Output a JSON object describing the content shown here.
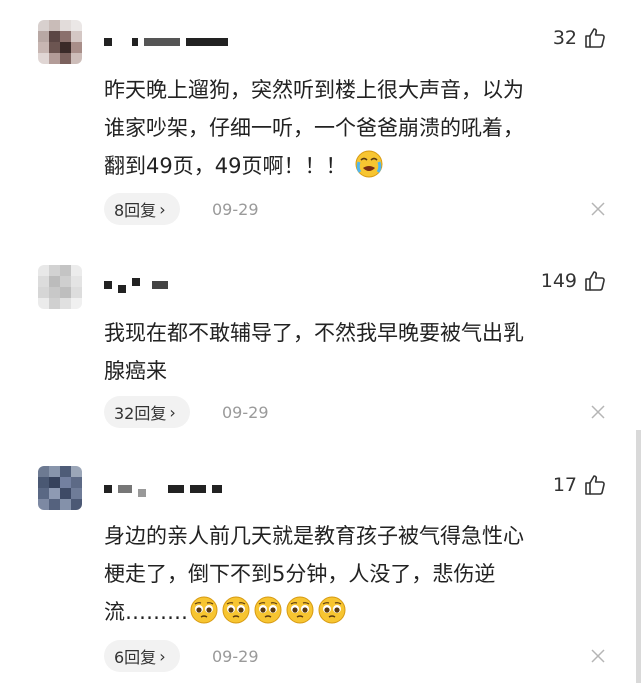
{
  "comments": [
    {
      "likes": "32",
      "text_lines": [
        "昨天晚上遛狗，突然听到楼上很大声音，以为",
        "谁家吵架，仔细一听，一个爸爸崩溃的吼着，",
        "翻到49页，49页啊！！！"
      ],
      "emoji_name": "crying-face-emoji",
      "reply_label": "8回复",
      "date": "09-29"
    },
    {
      "likes": "149",
      "text_lines": [
        "我现在都不敢辅导了，不然我早晚要被气出乳",
        "腺癌来"
      ],
      "reply_label": "32回复",
      "date": "09-29"
    },
    {
      "likes": "17",
      "text_lines": [
        "身边的亲人前几天就是教育孩子被气得急性心",
        "梗走了，倒下不到5分钟，人没了，悲伤逆",
        "流………"
      ],
      "emoji_name": "pleading-face-emoji",
      "emoji_count": 5,
      "reply_label": "6回复",
      "date": "09-29"
    }
  ],
  "reply_chevron": "›",
  "colors": {
    "text": "#222222",
    "meta": "#9a9a9a",
    "pill": "#f2f2f2"
  }
}
